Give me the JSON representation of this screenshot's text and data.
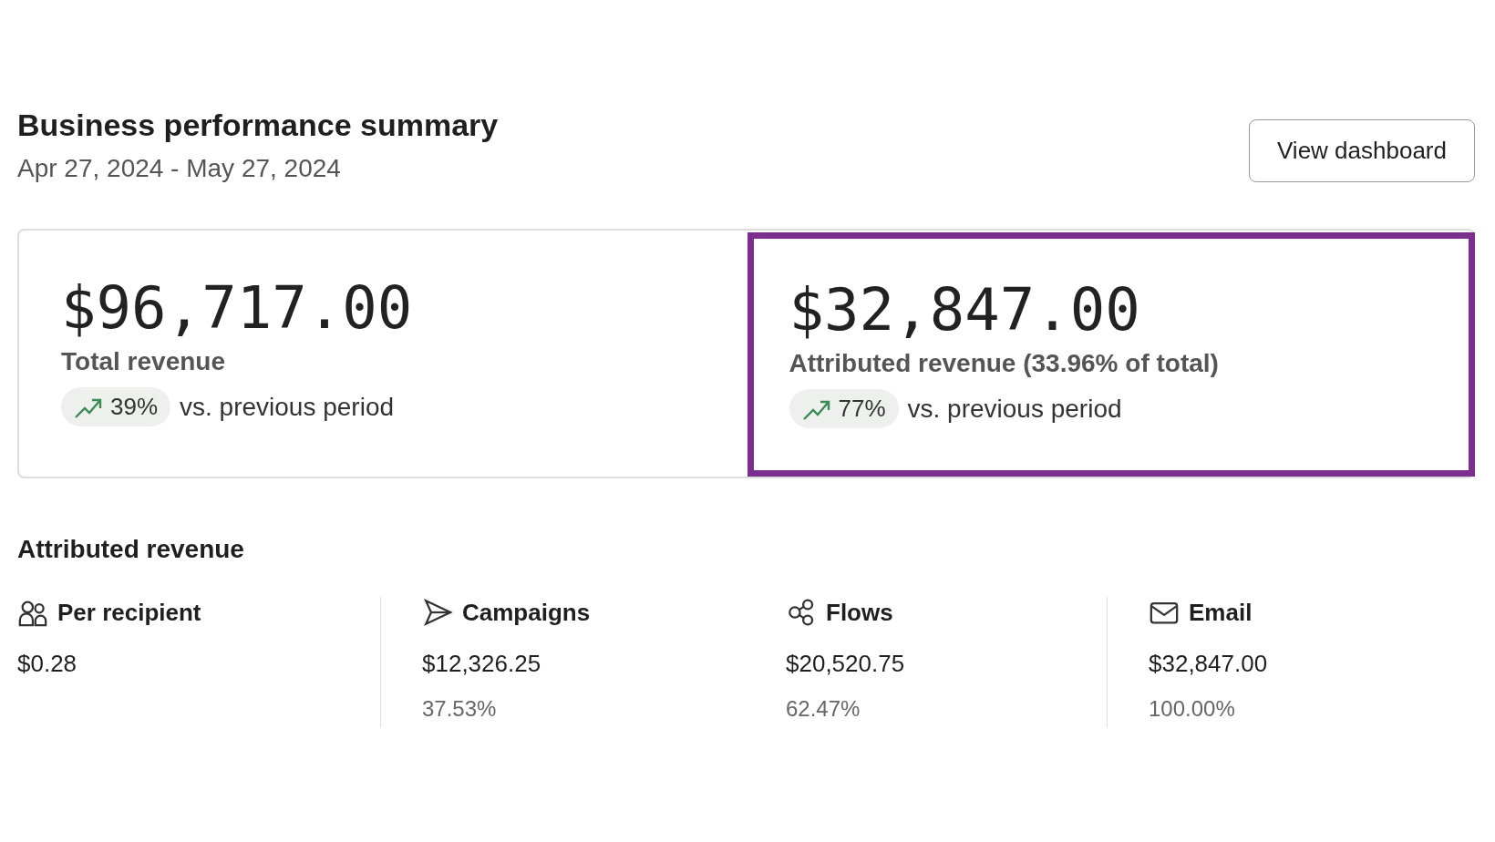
{
  "header": {
    "title": "Business performance summary",
    "date_range": "Apr 27, 2024 - May 27, 2024",
    "button": "View dashboard"
  },
  "metrics": [
    {
      "value": "$96,717.00",
      "label": "Total revenue",
      "change": "39%",
      "comparison": "vs. previous period",
      "highlighted": false
    },
    {
      "value": "$32,847.00",
      "label": "Attributed revenue (33.96% of total)",
      "change": "77%",
      "comparison": "vs. previous period",
      "highlighted": true
    }
  ],
  "section_title": "Attributed revenue",
  "breakdown": [
    {
      "kind": "people",
      "label": "Per recipient",
      "value": "$0.28"
    },
    {
      "kind": "send",
      "label": "Campaigns",
      "value": "$12,326.25",
      "share": "37.53%"
    },
    {
      "kind": "flows",
      "label": "Flows",
      "value": "$20,520.75",
      "share": "62.47%"
    },
    {
      "kind": "mail",
      "label": "Email",
      "value": "$32,847.00",
      "share": "100.00%"
    }
  ]
}
